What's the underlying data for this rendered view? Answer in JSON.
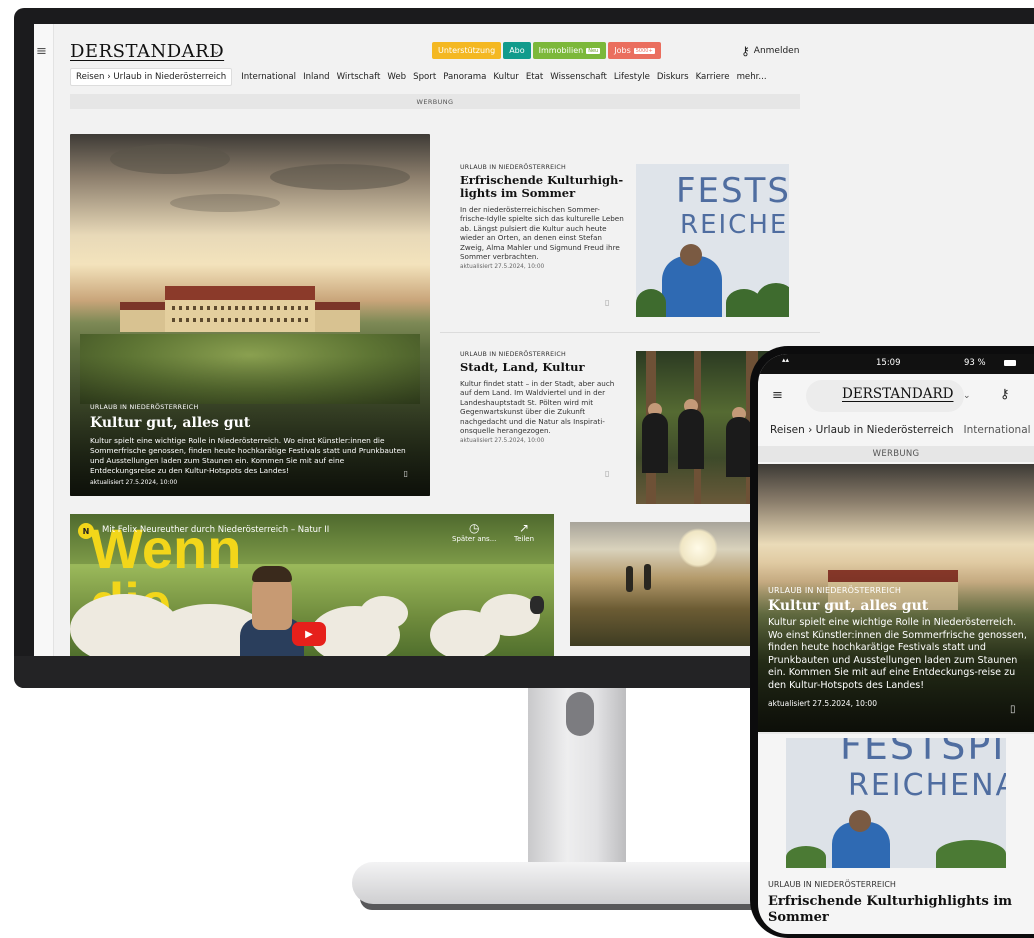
{
  "desktop": {
    "logo": "DERSTANDARD",
    "login_label": "Anmelden",
    "pills": [
      {
        "label": "Unterstützung",
        "color": "#f4b822",
        "tag": ""
      },
      {
        "label": "Abo",
        "color": "#129b8c",
        "tag": ""
      },
      {
        "label": "Immobilien",
        "color": "#7cb83a",
        "tag": "Neu"
      },
      {
        "label": "Jobs",
        "color": "#ea6e5e",
        "tag": "5000+"
      }
    ],
    "nav": {
      "current": "Reisen › Urlaub in Niederösterreich",
      "items": [
        "International",
        "Inland",
        "Wirtschaft",
        "Web",
        "Sport",
        "Panorama",
        "Kultur",
        "Etat",
        "Wissenschaft",
        "Lifestyle",
        "Diskurs",
        "Karriere",
        "mehr..."
      ]
    },
    "ad_label": "WERBUNG",
    "hero": {
      "kicker": "URLAUB IN NIEDERÖSTERREICH",
      "title": "Kultur gut, alles gut",
      "teaser": "Kultur spielt eine wichtige Rolle in Niederösterreich. Wo einst Künstler:innen die Sommerfrische genossen, finden heute hochkarätige Festivals statt und Prunkbauten und Ausstellungen laden zum Staunen ein. Kommen Sie mit auf eine Entdeckungsreise zu den Kultur-Hotspots des Landes!",
      "meta": "aktualisiert 27.5.2024, 10:00"
    },
    "articles": [
      {
        "kicker": "URLAUB IN NIEDERÖSTERREICH",
        "title": "Erfrischende Kulturhigh-lights im Sommer",
        "teaser": "In der niederösterreichischen Sommer-frische-Idylle spielte sich das kulturelle Leben ab. Längst pulsiert die Kultur auch heute wieder an Orten, an denen einst Stefan Zweig, Alma Mahler und Sigmund Freud ihre Sommer verbrachten.",
        "meta": "aktualisiert 27.5.2024, 10:00",
        "thumb_text1": "FESTSPIELE",
        "thumb_text2": "REICHENAU"
      },
      {
        "kicker": "URLAUB IN NIEDERÖSTERREICH",
        "title": "Stadt, Land, Kultur",
        "teaser": "Kultur findet statt – in der Stadt, aber auch auf dem Land. Im Waldviertel und in der Landeshauptstadt St. Pölten wird mit Gegenwartskunst über die Zukunft nachgedacht und die Natur als Inspirati-onsquelle herangezogen.",
        "meta": "aktualisiert 27.5.2024, 10:00"
      }
    ],
    "video": {
      "badge": "N",
      "title": "Mit Felix Neureuther durch Niederösterreich – Natur II",
      "overlay_text": "Wenn die",
      "watch_later": "Später ans...",
      "share": "Teilen"
    }
  },
  "phone": {
    "time": "15:09",
    "battery": "93 %",
    "logo": "DERSTANDARD",
    "nav_current": "Reisen › Urlaub in Niederösterreich",
    "nav_next": "International",
    "ad_label": "WERBUNG",
    "hero": {
      "kicker": "URLAUB IN NIEDERÖSTERREICH",
      "title": "Kultur gut, alles gut",
      "teaser": "Kultur spielt eine wichtige Rolle in Niederösterreich. Wo einst Künstler:innen die Sommerfrische genossen, finden heute hochkarätige Festivals statt und Prunkbauten und Ausstellungen laden zum Staunen ein. Kommen Sie mit auf eine Entdeckungs-reise zu den Kultur-Hotspots des Landes!",
      "meta": "aktualisiert 27.5.2024, 10:00"
    },
    "second": {
      "kicker": "URLAUB IN NIEDERÖSTERREICH",
      "title": "Erfrischende Kulturhighlights im Sommer",
      "thumb_text1": "FESTSPIELE",
      "thumb_text2": "REICHENAU"
    }
  },
  "icons": {
    "menu": "menu-search-icon",
    "key": "key-icon",
    "bookmark": "bookmark-icon",
    "clock": "clock-icon",
    "share": "share-icon",
    "play": "play-icon",
    "chevron": "chevron-down-icon"
  }
}
